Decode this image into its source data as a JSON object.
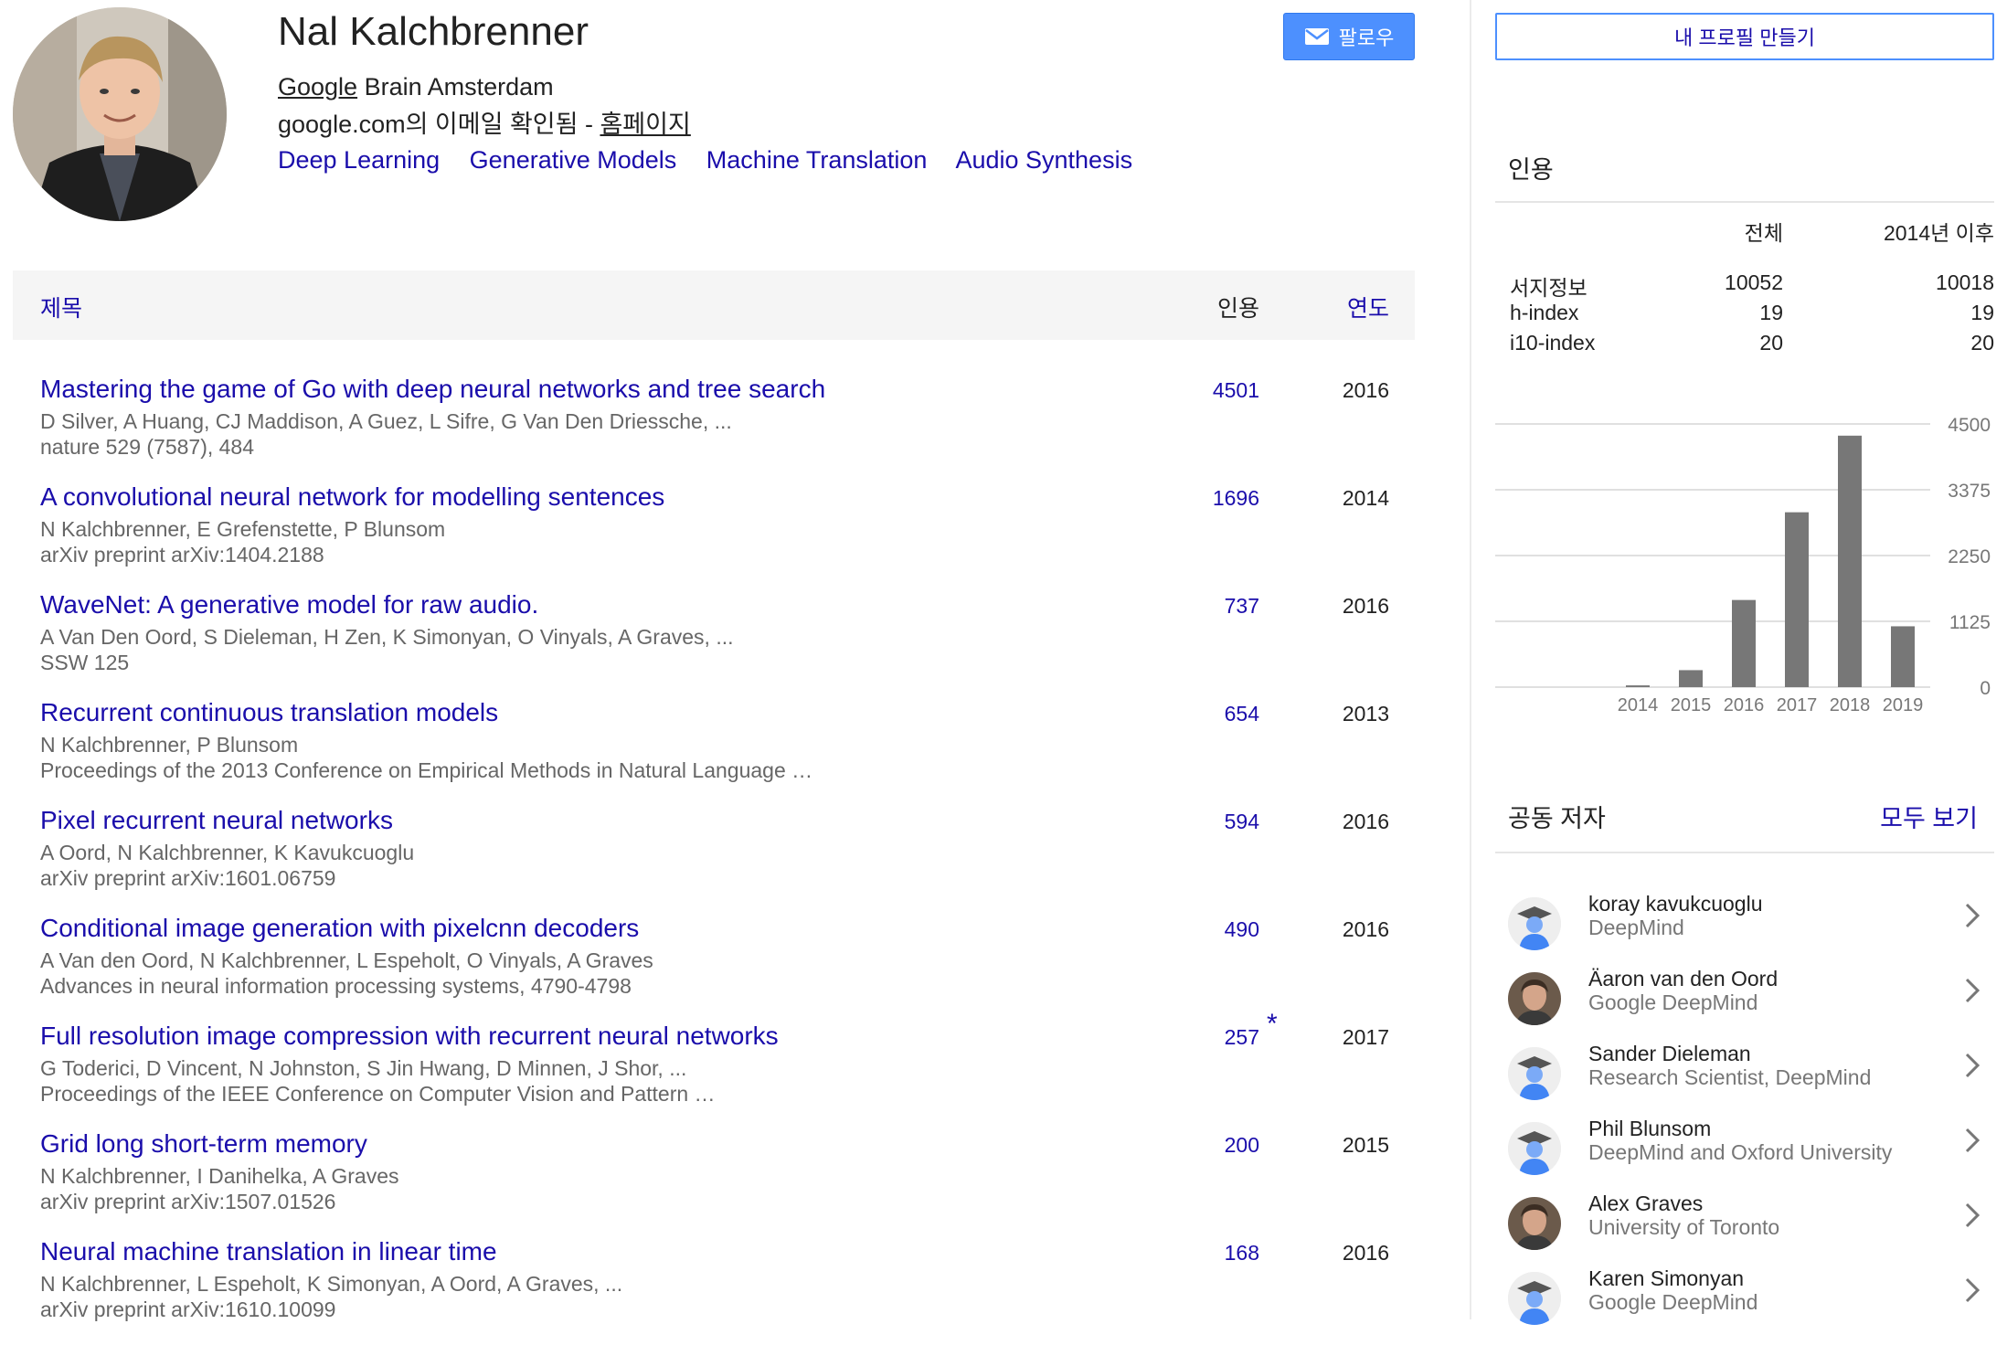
{
  "profile": {
    "name": "Nal Kalchbrenner",
    "org": "Google",
    "affiliation_rest": " Brain Amsterdam",
    "email_text": "google.com의 이메일 확인됨 - ",
    "homepage": "홈페이지",
    "interests": [
      "Deep Learning",
      "Generative Models",
      "Machine Translation",
      "Audio Synthesis"
    ],
    "follow_label": "팔로우"
  },
  "table": {
    "header_title": "제목",
    "header_cited": "인용",
    "header_year": "연도"
  },
  "publications": [
    {
      "title": "Mastering the game of Go with deep neural networks and tree search",
      "authors": "D Silver, A Huang, CJ Maddison, A Guez, L Sifre, G Van Den Driessche, ...",
      "venue": "nature 529 (7587), 484",
      "cited": "4501",
      "year": "2016",
      "star": ""
    },
    {
      "title": "A convolutional neural network for modelling sentences",
      "authors": "N Kalchbrenner, E Grefenstette, P Blunsom",
      "venue": "arXiv preprint arXiv:1404.2188",
      "cited": "1696",
      "year": "2014",
      "star": ""
    },
    {
      "title": "WaveNet: A generative model for raw audio.",
      "authors": "A Van Den Oord, S Dieleman, H Zen, K Simonyan, O Vinyals, A Graves, ...",
      "venue": "SSW 125",
      "cited": "737",
      "year": "2016",
      "star": ""
    },
    {
      "title": "Recurrent continuous translation models",
      "authors": "N Kalchbrenner, P Blunsom",
      "venue": "Proceedings of the 2013 Conference on Empirical Methods in Natural Language …",
      "cited": "654",
      "year": "2013",
      "star": ""
    },
    {
      "title": "Pixel recurrent neural networks",
      "authors": "A Oord, N Kalchbrenner, K Kavukcuoglu",
      "venue": "arXiv preprint arXiv:1601.06759",
      "cited": "594",
      "year": "2016",
      "star": ""
    },
    {
      "title": "Conditional image generation with pixelcnn decoders",
      "authors": "A Van den Oord, N Kalchbrenner, L Espeholt, O Vinyals, A Graves",
      "venue": "Advances in neural information processing systems, 4790-4798",
      "cited": "490",
      "year": "2016",
      "star": ""
    },
    {
      "title": "Full resolution image compression with recurrent neural networks",
      "authors": "G Toderici, D Vincent, N Johnston, S Jin Hwang, D Minnen, J Shor, ...",
      "venue": "Proceedings of the IEEE Conference on Computer Vision and Pattern …",
      "cited": "257",
      "year": "2017",
      "star": "*"
    },
    {
      "title": "Grid long short-term memory",
      "authors": "N Kalchbrenner, I Danihelka, A Graves",
      "venue": "arXiv preprint arXiv:1507.01526",
      "cited": "200",
      "year": "2015",
      "star": ""
    },
    {
      "title": "Neural machine translation in linear time",
      "authors": "N Kalchbrenner, L Espeholt, K Simonyan, A Oord, A Graves, ...",
      "venue": "arXiv preprint arXiv:1610.10099",
      "cited": "168",
      "year": "2016",
      "star": ""
    }
  ],
  "sidebar": {
    "create_profile_label": "내 프로필 만들기",
    "citations_heading": "인용",
    "stats_header_all": "전체",
    "stats_header_since": "2014년 이후",
    "stats_rows": [
      {
        "label": "서지정보",
        "all": "10052",
        "since": "10018"
      },
      {
        "label": "h-index",
        "all": "19",
        "since": "19"
      },
      {
        "label": "i10-index",
        "all": "20",
        "since": "20"
      }
    ],
    "coauthors_heading": "공동 저자",
    "coauthors_view_all": "모두 보기",
    "coauthors": [
      {
        "name": "koray kavukcuoglu",
        "affiliation": "DeepMind",
        "avatar": "default"
      },
      {
        "name": "Äaron van den Oord",
        "affiliation": "Google DeepMind",
        "avatar": "photo"
      },
      {
        "name": "Sander Dieleman",
        "affiliation": "Research Scientist, DeepMind",
        "avatar": "default"
      },
      {
        "name": "Phil Blunsom",
        "affiliation": "DeepMind and Oxford University",
        "avatar": "default"
      },
      {
        "name": "Alex Graves",
        "affiliation": "University of Toronto",
        "avatar": "photo"
      },
      {
        "name": "Karen Simonyan",
        "affiliation": "Google DeepMind",
        "avatar": "default"
      }
    ]
  },
  "chart_data": {
    "type": "bar",
    "categories": [
      "2014",
      "2015",
      "2016",
      "2017",
      "2018",
      "2019"
    ],
    "values": [
      30,
      290,
      1490,
      2990,
      4300,
      1040
    ],
    "yticks": [
      "4500",
      "3375",
      "2250",
      "1125",
      "0"
    ],
    "ylim": [
      0,
      4500
    ],
    "bar_color": "#777777"
  },
  "colors": {
    "link": "#1a0dab",
    "follow_button": "#4d90fe"
  }
}
